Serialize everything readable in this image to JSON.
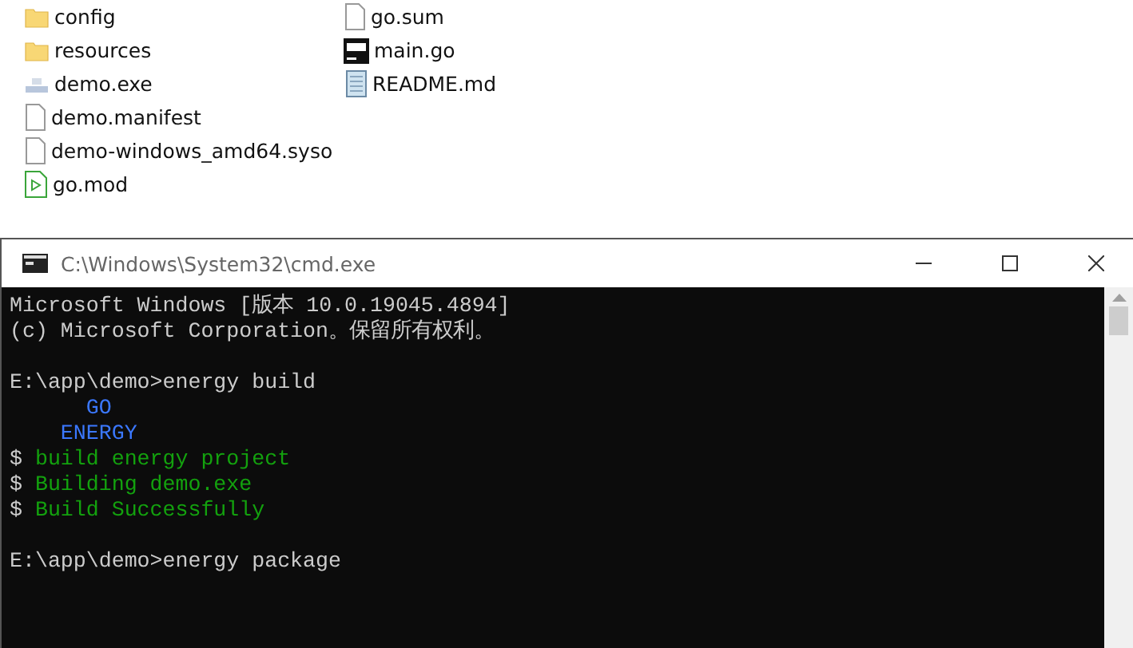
{
  "files": [
    {
      "name": "config",
      "kind": "folder"
    },
    {
      "name": "resources",
      "kind": "folder"
    },
    {
      "name": "demo.exe",
      "kind": "app"
    },
    {
      "name": "demo.manifest",
      "kind": "file"
    },
    {
      "name": "demo-windows_amd64.syso",
      "kind": "file"
    },
    {
      "name": "go.mod",
      "kind": "gomod"
    },
    {
      "name": "go.sum",
      "kind": "file"
    },
    {
      "name": "main.go",
      "kind": "go"
    },
    {
      "name": "README.md",
      "kind": "text"
    }
  ],
  "console_window": {
    "title": "C:\\Windows\\System32\\cmd.exe",
    "lines": [
      {
        "kind": "text",
        "segments": [
          {
            "text": "Microsoft Windows [版本 10.0.19045.4894]",
            "color": "#cccccc"
          }
        ]
      },
      {
        "kind": "text",
        "segments": [
          {
            "text": "(c) Microsoft Corporation。保留所有权利。",
            "color": "#cccccc"
          }
        ]
      },
      {
        "kind": "blank"
      },
      {
        "kind": "text",
        "segments": [
          {
            "text": "E:\\app\\demo>energy build",
            "color": "#cccccc"
          }
        ]
      },
      {
        "kind": "text",
        "segments": [
          {
            "text": "      GO",
            "color": "#3b78ff"
          }
        ]
      },
      {
        "kind": "text",
        "segments": [
          {
            "text": "    ENERGY",
            "color": "#3b78ff"
          }
        ]
      },
      {
        "kind": "text",
        "segments": [
          {
            "text": "$ ",
            "color": "#cccccc"
          },
          {
            "text": "build energy project",
            "color": "#13a10e"
          }
        ]
      },
      {
        "kind": "text",
        "segments": [
          {
            "text": "$ ",
            "color": "#cccccc"
          },
          {
            "text": "Building demo.exe",
            "color": "#13a10e"
          }
        ]
      },
      {
        "kind": "text",
        "segments": [
          {
            "text": "$ ",
            "color": "#cccccc"
          },
          {
            "text": "Build Successfully",
            "color": "#13a10e"
          }
        ]
      },
      {
        "kind": "blank"
      },
      {
        "kind": "text",
        "segments": [
          {
            "text": "E:\\app\\demo>energy package",
            "color": "#cccccc"
          }
        ]
      }
    ]
  }
}
